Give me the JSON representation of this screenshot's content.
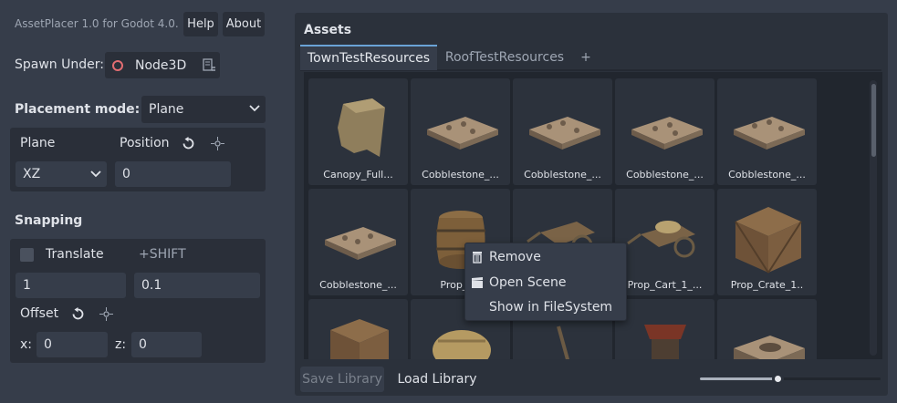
{
  "app": {
    "title": "AssetPlacer 1.0 for Godot 4.0.",
    "help_label": "Help",
    "about_label": "About"
  },
  "spawn": {
    "label": "Spawn Under:",
    "node": "Node3D"
  },
  "placement": {
    "label": "Placement mode:",
    "mode": "Plane",
    "plane_label": "Plane",
    "position_label": "Position",
    "plane_value": "XZ",
    "position_value": "0"
  },
  "snapping": {
    "title": "Snapping",
    "translate_label": "Translate",
    "translate_checked": false,
    "shift_label": "+SHIFT",
    "translate_value": "1",
    "shift_value": "0.1",
    "offset_label": "Offset",
    "x_label": "x:",
    "x_value": "0",
    "z_label": "z:",
    "z_value": "0"
  },
  "assets": {
    "title": "Assets",
    "tabs": [
      {
        "label": "TownTestResources",
        "active": true
      },
      {
        "label": "RoofTestResources",
        "active": false
      }
    ],
    "add_tab_label": "+",
    "tiles": [
      {
        "caption": "Canopy_Full...",
        "icon": "canopy"
      },
      {
        "caption": "Cobblestone_...",
        "icon": "cobblestone"
      },
      {
        "caption": "Cobblestone_...",
        "icon": "cobblestone"
      },
      {
        "caption": "Cobblestone_...",
        "icon": "cobblestone"
      },
      {
        "caption": "Cobblestone_...",
        "icon": "cobblestone"
      },
      {
        "caption": "Cobblestone_...",
        "icon": "cobblestone"
      },
      {
        "caption": "Prop_Ba",
        "icon": "barrel"
      },
      {
        "caption": "",
        "icon": "cart"
      },
      {
        "caption": "Prop_Cart_1_...",
        "icon": "cart"
      },
      {
        "caption": "Prop_Crate_1..",
        "icon": "crate"
      },
      {
        "caption": "",
        "icon": "crate"
      },
      {
        "caption": "",
        "icon": "hay"
      },
      {
        "caption": "",
        "icon": "stick"
      },
      {
        "caption": "",
        "icon": "well"
      },
      {
        "caption": "",
        "icon": "slab"
      }
    ],
    "context_menu": [
      {
        "label": "Remove",
        "icon": "trash-icon"
      },
      {
        "label": "Open Scene",
        "icon": "clapper-icon"
      },
      {
        "label": "Show in FileSystem",
        "icon": ""
      }
    ],
    "save_label": "Save Library",
    "load_label": "Load Library",
    "zoom_level": 0.43
  },
  "colors": {
    "accent": "#6aa3d6",
    "node_ring": "#e26d72",
    "panel": "#2b313b",
    "background": "#363d4a"
  }
}
